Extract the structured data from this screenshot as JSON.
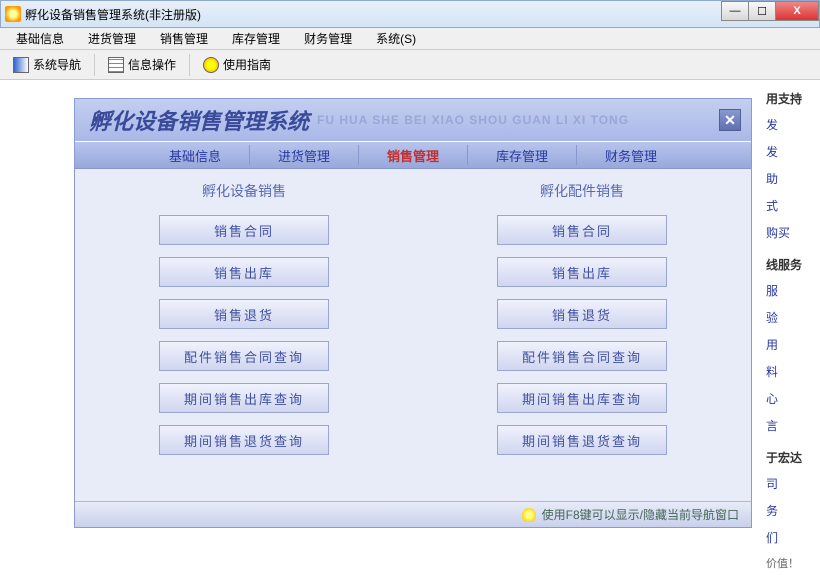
{
  "window": {
    "title": "孵化设备销售管理系统(非注册版)"
  },
  "win_controls": {
    "min": "—",
    "max": "☐",
    "close": "X"
  },
  "menubar": [
    "基础信息",
    "进货管理",
    "销售管理",
    "库存管理",
    "财务管理",
    "系统(S)"
  ],
  "toolbar": {
    "nav": "系统导航",
    "info": "信息操作",
    "help": "使用指南"
  },
  "panel": {
    "title": "孵化设备销售管理系统",
    "subtitle": "FU HUA SHE BEI XIAO SHOU GUAN LI XI TONG",
    "tabs": [
      "基础信息",
      "进货管理",
      "销售管理",
      "库存管理",
      "财务管理"
    ],
    "active_tab_index": 2,
    "columns": [
      {
        "title": "孵化设备销售",
        "buttons": [
          "销售合同",
          "销售出库",
          "销售退货",
          "配件销售合同查询",
          "期间销售出库查询",
          "期间销售退货查询"
        ]
      },
      {
        "title": "孵化配件销售",
        "buttons": [
          "销售合同",
          "销售出库",
          "销售退货",
          "配件销售合同查询",
          "期间销售出库查询",
          "期间销售退货查询"
        ]
      }
    ],
    "footer_hint": "使用F8键可以显示/隐藏当前导航窗口"
  },
  "right_sidebar": {
    "g1_header": "用支持",
    "g1_items": [
      "发",
      "发",
      "助",
      "式",
      "购买"
    ],
    "g2_header": "线服务",
    "g2_items": [
      "服",
      "验",
      "用",
      "料",
      "心",
      "言"
    ],
    "g3_header": "于宏达",
    "g3_items": [
      "司",
      "务",
      "们"
    ],
    "footer": "价值！"
  }
}
